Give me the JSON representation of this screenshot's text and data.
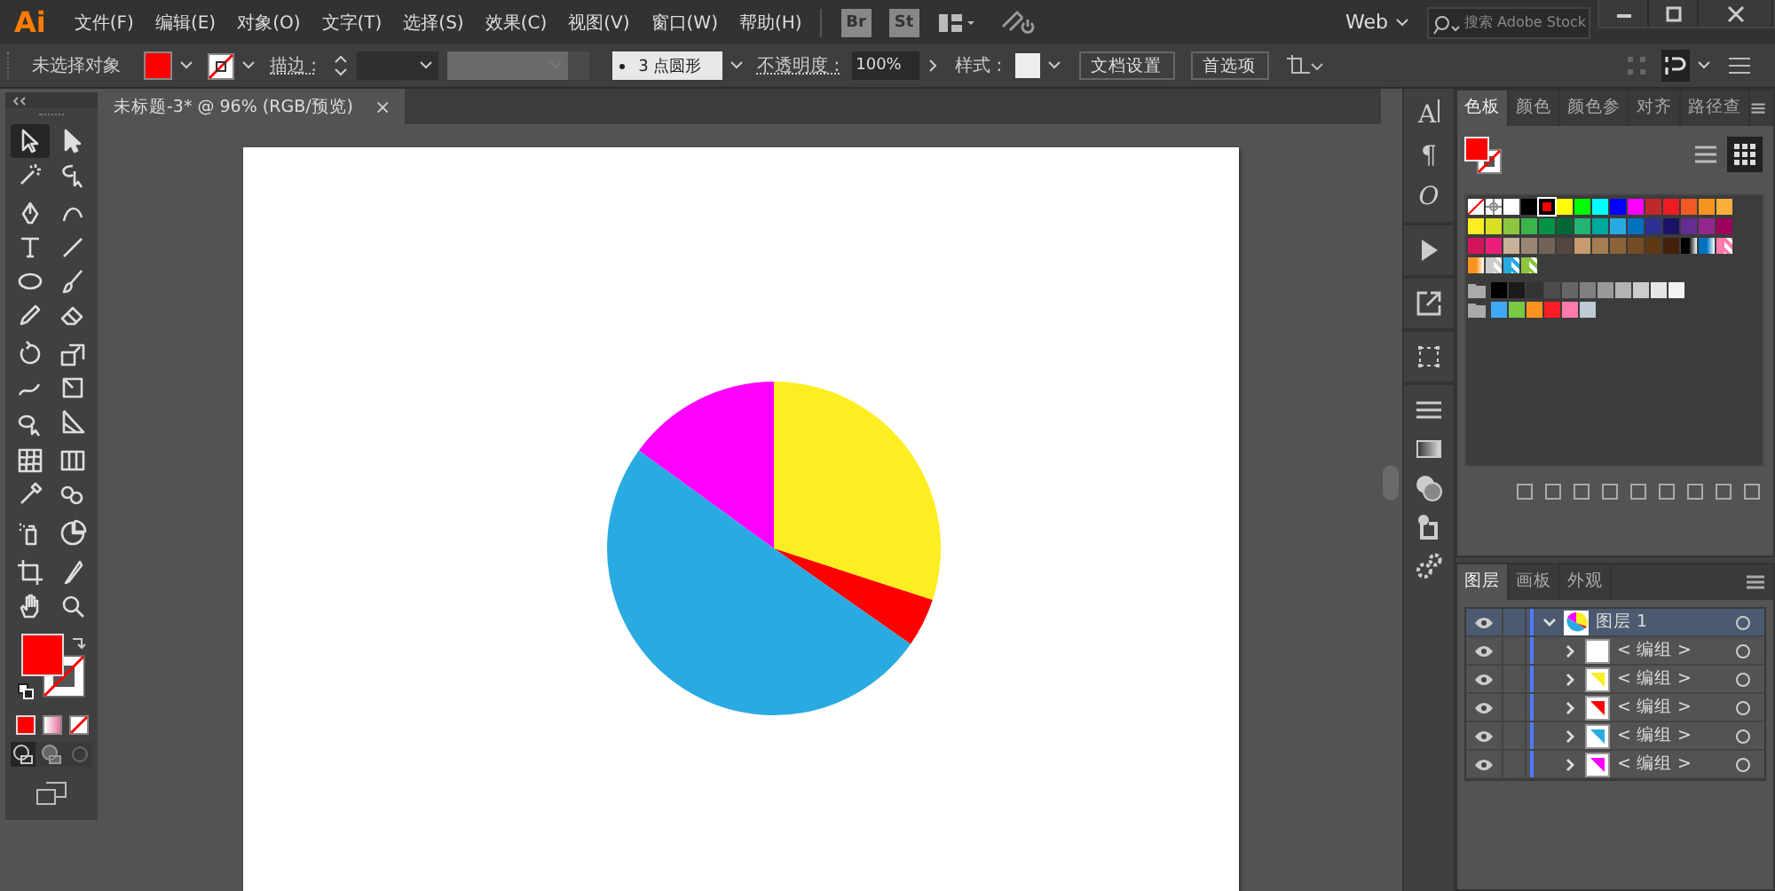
{
  "app": {
    "logo": "Ai",
    "bridge": "Br",
    "stock": "St"
  },
  "menu": [
    "文件(F)",
    "编辑(E)",
    "对象(O)",
    "文字(T)",
    "选择(S)",
    "效果(C)",
    "视图(V)",
    "窗口(W)",
    "帮助(H)"
  ],
  "menubar_right": {
    "workspace": "Web",
    "search_placeholder": "搜索 Adobe Stock"
  },
  "control_bar": {
    "selection": "未选择对象",
    "fill": {
      "color": "#ff0000"
    },
    "stroke_label": "描边 :",
    "brush": "3 点圆形",
    "opacity_label": "不透明度 :",
    "opacity": "100%",
    "style_label": "样式 :",
    "buttons": [
      "文档设置",
      "首选项"
    ]
  },
  "document_tab": {
    "title": "未标题-3* @ 96% (RGB/预览)",
    "close": "×"
  },
  "toolbar": {
    "fill": {
      "color": "#ff0000"
    },
    "tools": [
      {
        "selected": true
      },
      {
        "selected": false
      },
      {
        "selected": false
      },
      {
        "selected": false
      },
      {
        "selected": false
      },
      {
        "selected": false
      },
      {
        "selected": false
      },
      {
        "selected": false
      },
      {
        "selected": false
      },
      {
        "selected": false
      },
      {
        "selected": false
      },
      {
        "selected": false
      },
      {
        "selected": false
      },
      {
        "selected": false
      },
      {
        "selected": false
      },
      {
        "selected": false
      },
      {
        "selected": false
      },
      {
        "selected": false
      },
      {
        "selected": false
      },
      {
        "selected": false
      },
      {
        "selected": false
      },
      {
        "selected": false
      },
      {
        "selected": false
      },
      {
        "selected": false
      },
      {
        "selected": false
      },
      {
        "selected": false
      },
      {
        "selected": false
      },
      {
        "selected": false
      }
    ]
  },
  "dock": {
    "glyphs": [
      "A",
      "¶",
      "O"
    ]
  },
  "swatches_panel": {
    "tabs": [
      {
        "label": "色板",
        "selected": true
      },
      {
        "label": "颜色",
        "selected": false
      },
      {
        "label": "颜色参",
        "selected": false
      },
      {
        "label": "对齐",
        "selected": false
      },
      {
        "label": "路径查",
        "selected": false
      }
    ],
    "fill": {
      "color": "#ff0000"
    },
    "rows": [
      {
        "swatches": [
          {
            "kind": "none",
            "selected": false
          },
          {
            "kind": "registration",
            "selected": false
          },
          {
            "kind": "color",
            "color": "#ffffff",
            "selected": false
          },
          {
            "kind": "color",
            "color": "#000000",
            "selected": false
          },
          {
            "kind": "color",
            "color": "#ff0000",
            "selected": true
          },
          {
            "kind": "color",
            "color": "#ffff00",
            "selected": false
          },
          {
            "kind": "color",
            "color": "#00ff00",
            "selected": false
          },
          {
            "kind": "color",
            "color": "#00ffff",
            "selected": false
          },
          {
            "kind": "color",
            "color": "#0000ff",
            "selected": false
          },
          {
            "kind": "color",
            "color": "#ff00ff",
            "selected": false
          },
          {
            "kind": "color",
            "color": "#c1272d",
            "selected": false
          },
          {
            "kind": "color",
            "color": "#ed1c24",
            "selected": false
          },
          {
            "kind": "color",
            "color": "#f15a24",
            "selected": false
          },
          {
            "kind": "color",
            "color": "#f7931e",
            "selected": false
          },
          {
            "kind": "color",
            "color": "#fbb03b",
            "selected": false
          }
        ]
      },
      {
        "swatches": [
          {
            "kind": "color",
            "color": "#fcee21",
            "selected": false
          },
          {
            "kind": "color",
            "color": "#d9e021",
            "selected": false
          },
          {
            "kind": "color",
            "color": "#8cc63f",
            "selected": false
          },
          {
            "kind": "color",
            "color": "#39b54a",
            "selected": false
          },
          {
            "kind": "color",
            "color": "#009245",
            "selected": false
          },
          {
            "kind": "color",
            "color": "#006837",
            "selected": false
          },
          {
            "kind": "color",
            "color": "#22b573",
            "selected": false
          },
          {
            "kind": "color",
            "color": "#00a99d",
            "selected": false
          },
          {
            "kind": "color",
            "color": "#29abe2",
            "selected": false
          },
          {
            "kind": "color",
            "color": "#0071bc",
            "selected": false
          },
          {
            "kind": "color",
            "color": "#2e3192",
            "selected": false
          },
          {
            "kind": "color",
            "color": "#1b1464",
            "selected": false
          },
          {
            "kind": "color",
            "color": "#662d91",
            "selected": false
          },
          {
            "kind": "color",
            "color": "#93278f",
            "selected": false
          },
          {
            "kind": "color",
            "color": "#9e005d",
            "selected": false
          }
        ]
      },
      {
        "swatches": [
          {
            "kind": "color",
            "color": "#d4145a",
            "selected": false
          },
          {
            "kind": "color",
            "color": "#ed1e79",
            "selected": false
          },
          {
            "kind": "color",
            "color": "#c7b299",
            "selected": false
          },
          {
            "kind": "color",
            "color": "#998675",
            "selected": false
          },
          {
            "kind": "color",
            "color": "#736357",
            "selected": false
          },
          {
            "kind": "color",
            "color": "#534741",
            "selected": false
          },
          {
            "kind": "color",
            "color": "#c69c6d",
            "selected": false
          },
          {
            "kind": "color",
            "color": "#a67c52",
            "selected": false
          },
          {
            "kind": "color",
            "color": "#8c6239",
            "selected": false
          },
          {
            "kind": "color",
            "color": "#754c24",
            "selected": false
          },
          {
            "kind": "color",
            "color": "#603813",
            "selected": false
          },
          {
            "kind": "color",
            "color": "#42210b",
            "selected": false
          },
          {
            "kind": "gradient",
            "color": "#000000",
            "selected": false
          },
          {
            "kind": "gradient",
            "color": "#0071bc",
            "selected": false
          },
          {
            "kind": "pattern",
            "color": "#ff7bac",
            "selected": false
          }
        ]
      },
      {
        "swatches": [
          {
            "kind": "gradient",
            "color": "#f7931e",
            "selected": false
          },
          {
            "kind": "pattern",
            "color": "#cccccc",
            "selected": false
          },
          {
            "kind": "pattern",
            "color": "#29abe2",
            "selected": false
          },
          {
            "kind": "pattern",
            "color": "#8cc63f",
            "selected": false
          }
        ]
      },
      {
        "swatches": [
          {
            "kind": "folder"
          },
          {
            "kind": "color",
            "color": "#000000",
            "selected": false
          },
          {
            "kind": "color",
            "color": "#1a1a1a",
            "selected": false
          },
          {
            "kind": "color",
            "color": "#333333",
            "selected": false
          },
          {
            "kind": "color",
            "color": "#4d4d4d",
            "selected": false
          },
          {
            "kind": "color",
            "color": "#666666",
            "selected": false
          },
          {
            "kind": "color",
            "color": "#808080",
            "selected": false
          },
          {
            "kind": "color",
            "color": "#999999",
            "selected": false
          },
          {
            "kind": "color",
            "color": "#b3b3b3",
            "selected": false
          },
          {
            "kind": "color",
            "color": "#cccccc",
            "selected": false
          },
          {
            "kind": "color",
            "color": "#e6e6e6",
            "selected": false
          },
          {
            "kind": "color",
            "color": "#f2f2f2",
            "selected": false
          }
        ]
      },
      {
        "swatches": [
          {
            "kind": "folder"
          },
          {
            "kind": "color",
            "color": "#3fa9f5",
            "selected": false
          },
          {
            "kind": "color",
            "color": "#7ac943",
            "selected": false
          },
          {
            "kind": "color",
            "color": "#ff931e",
            "selected": false
          },
          {
            "kind": "color",
            "color": "#ff1d25",
            "selected": false
          },
          {
            "kind": "color",
            "color": "#ff7bac",
            "selected": false
          },
          {
            "kind": "color",
            "color": "#bdccd4",
            "selected": false
          }
        ]
      }
    ]
  },
  "layers_panel": {
    "tabs": [
      {
        "label": "图层",
        "selected": true
      },
      {
        "label": "画板",
        "selected": false
      },
      {
        "label": "外观",
        "selected": false
      }
    ],
    "layers": [
      {
        "name": "图层 1",
        "visible": true,
        "expanded": true,
        "selected": true,
        "children": [
          {
            "name": "< 编组 >",
            "visible": true,
            "expanded": false,
            "selected": false
          },
          {
            "name": "< 编组 >",
            "visible": true,
            "expanded": false,
            "selected": false,
            "color": "#fcee21"
          },
          {
            "name": "< 编组 >",
            "visible": true,
            "expanded": false,
            "selected": false,
            "color": "#ff0000"
          },
          {
            "name": "< 编组 >",
            "visible": true,
            "expanded": false,
            "selected": false,
            "color": "#29abe2"
          },
          {
            "name": "< 编组 >",
            "visible": true,
            "expanded": false,
            "selected": false,
            "color": "#ff00ff"
          }
        ]
      }
    ]
  }
}
